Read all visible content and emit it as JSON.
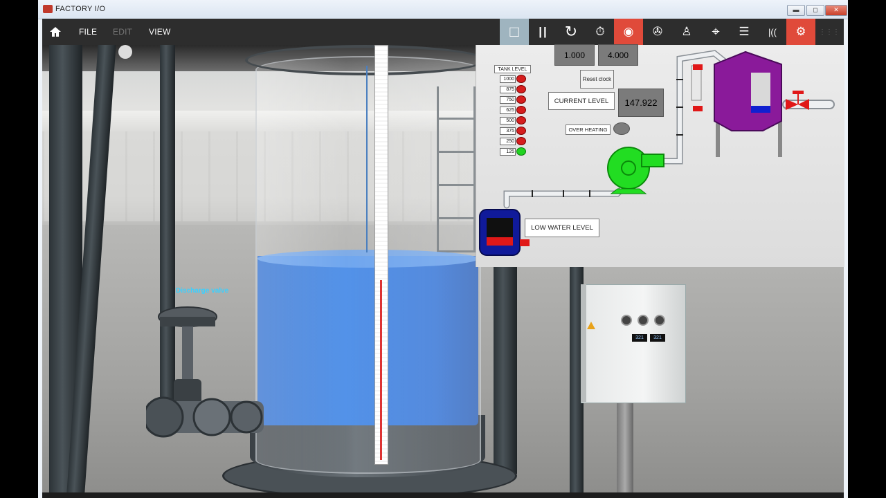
{
  "window": {
    "title": "FACTORY I/O",
    "controls": {
      "minimize": "▬",
      "maximize": "◻",
      "close": "✕"
    }
  },
  "menu": {
    "home_icon": "home-icon",
    "items": [
      {
        "label": "FILE",
        "enabled": true
      },
      {
        "label": "EDIT",
        "enabled": false
      },
      {
        "label": "VIEW",
        "enabled": true
      }
    ]
  },
  "toolbar_icons": [
    {
      "name": "stop-icon",
      "glyph": "□",
      "state": "active"
    },
    {
      "name": "pause-icon",
      "glyph": "||",
      "state": "normal"
    },
    {
      "name": "reset-icon",
      "glyph": "↻",
      "state": "normal"
    },
    {
      "name": "timer-icon",
      "glyph": "⏱",
      "state": "normal"
    },
    {
      "name": "drivers-icon",
      "glyph": "◉",
      "state": "red"
    },
    {
      "name": "fan-icon",
      "glyph": "✇",
      "state": "normal"
    },
    {
      "name": "person-icon",
      "glyph": "♙",
      "state": "normal"
    },
    {
      "name": "target-icon",
      "glyph": "⌖",
      "state": "normal"
    },
    {
      "name": "list-icon",
      "glyph": "☰",
      "state": "normal"
    },
    {
      "name": "sensor-icon",
      "glyph": "|((",
      "state": "normal"
    },
    {
      "name": "gears-icon",
      "glyph": "⚙",
      "state": "red"
    },
    {
      "name": "grid-icon",
      "glyph": "⋮⋮⋮",
      "state": "dim"
    }
  ],
  "hmi": {
    "display_a": "1.000",
    "display_b": "4.000",
    "reset_clock_label": "Reset clock",
    "current_level_label": "CURRENT LEVEL",
    "current_level_value": "147.922",
    "over_heating_label": "OVER HEATING",
    "low_water_label": "LOW WATER LEVEL",
    "tank_level_title": "TANK LEVEL",
    "tank_levels": [
      {
        "value": "1000",
        "on": false
      },
      {
        "value": "875",
        "on": false
      },
      {
        "value": "750",
        "on": false
      },
      {
        "value": "625",
        "on": false
      },
      {
        "value": "500",
        "on": false
      },
      {
        "value": "375",
        "on": false
      },
      {
        "value": "250",
        "on": false
      },
      {
        "value": "125",
        "on": true
      }
    ],
    "colors": {
      "led_on": "#22d322",
      "led_off": "#d61e1e",
      "pump": "#22dd22",
      "tank": "#8a1a9a",
      "reservoir": "#101a9a"
    }
  },
  "scene": {
    "discharge_valve_label": "Discharge valve",
    "tank_water_level": 0.41,
    "cabinet_displays": [
      "321",
      "321"
    ]
  },
  "accent_colors": {
    "toolbar_bg": "#2d2d2d",
    "active": "#9fb4bf",
    "alert": "#e04a3a"
  }
}
